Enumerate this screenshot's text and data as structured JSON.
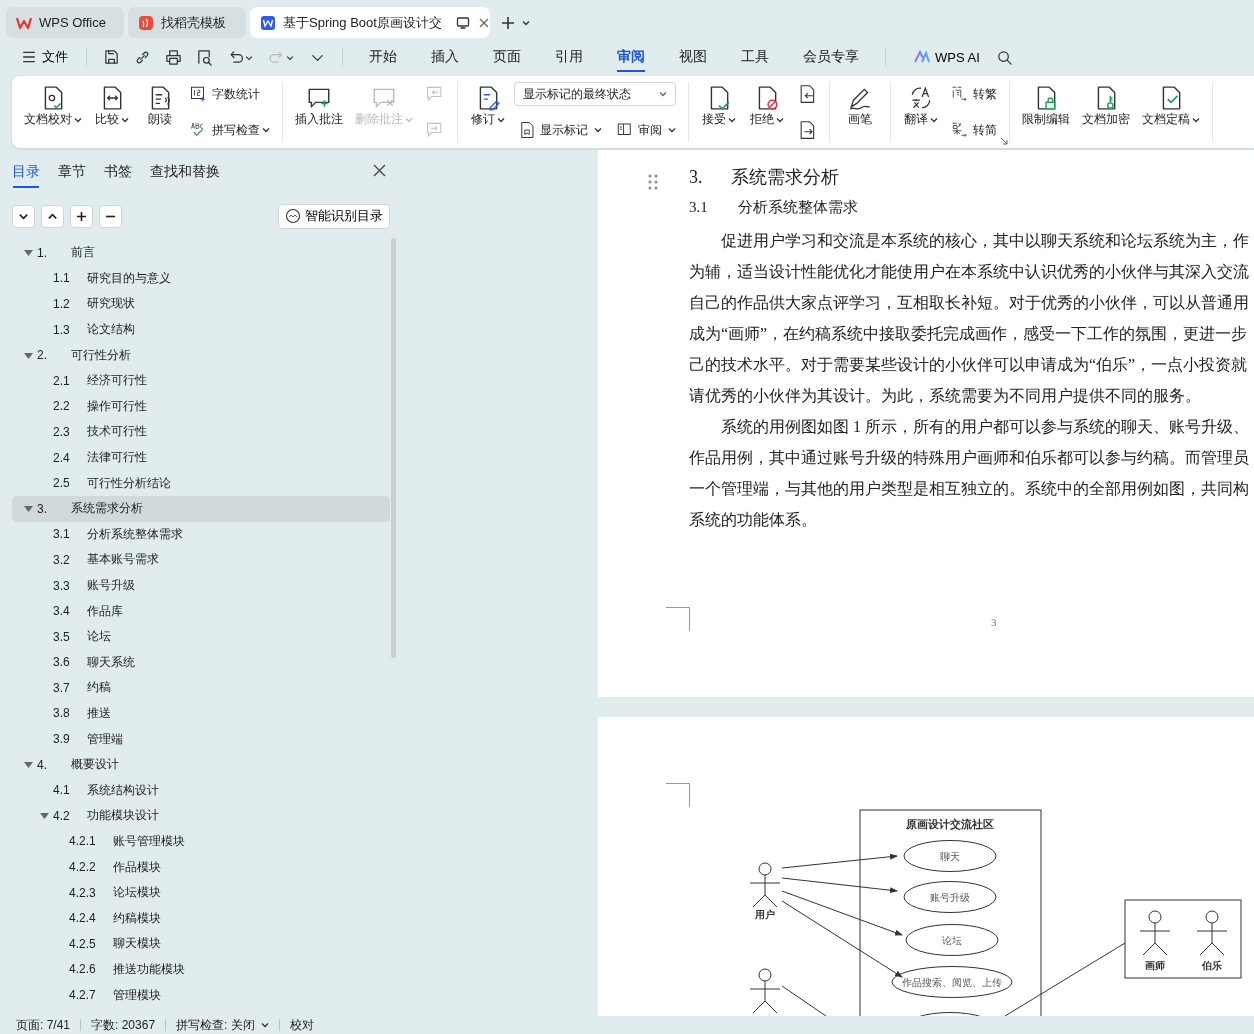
{
  "app_tabs": [
    {
      "kind": "home",
      "label": "WPS Office",
      "selected": false
    },
    {
      "kind": "template",
      "label": "找稻壳模板",
      "selected": false
    },
    {
      "kind": "document",
      "label": "基于Spring Boot原画设计交",
      "selected": true
    }
  ],
  "menu": {
    "file": "文件",
    "tabs": [
      {
        "label": "开始",
        "selected": false
      },
      {
        "label": "插入",
        "selected": false
      },
      {
        "label": "页面",
        "selected": false
      },
      {
        "label": "引用",
        "selected": false
      },
      {
        "label": "审阅",
        "selected": true
      },
      {
        "label": "视图",
        "selected": false
      },
      {
        "label": "工具",
        "selected": false
      },
      {
        "label": "会员专享",
        "selected": false
      }
    ],
    "ai": "WPS AI"
  },
  "ribbon": [
    [
      [
        {
          "kind": "large",
          "label": "文档校对",
          "caret": true,
          "disabled": false
        }
      ],
      [
        {
          "kind": "large",
          "label": "比较",
          "caret": true,
          "disabled": false
        }
      ],
      [
        {
          "kind": "large",
          "label": "朗读",
          "caret": false,
          "disabled": false
        }
      ],
      [
        {
          "kind": "small",
          "label": "字数统计",
          "caret": false,
          "disabled": false
        },
        {
          "kind": "small",
          "label": "拼写检查",
          "caret": true,
          "disabled": false
        }
      ]
    ],
    [
      [
        {
          "kind": "large",
          "label": "插入批注",
          "caret": false,
          "disabled": false
        }
      ],
      [
        {
          "kind": "large",
          "label": "删除批注",
          "caret": true,
          "disabled": true
        }
      ],
      [
        {
          "kind": "icon",
          "disabled": true
        },
        {
          "kind": "icon",
          "disabled": true
        }
      ]
    ],
    [
      [
        {
          "kind": "large",
          "label": "修订",
          "caret": true,
          "disabled": false
        }
      ],
      [
        {
          "kind": "select",
          "label": "显示标记的最终状态"
        },
        {
          "kind": "pair",
          "items": [
            {
              "label": "显示标记",
              "caret": true
            },
            {
              "label": "审阅",
              "caret": true
            }
          ]
        }
      ]
    ],
    [
      [
        {
          "kind": "large",
          "label": "接受",
          "caret": true,
          "disabled": false
        }
      ],
      [
        {
          "kind": "large",
          "label": "拒绝",
          "caret": true,
          "disabled": false
        }
      ],
      [
        {
          "kind": "icon",
          "disabled": false
        },
        {
          "kind": "icon",
          "disabled": false
        }
      ]
    ],
    [
      [
        {
          "kind": "large",
          "label": "画笔",
          "caret": false,
          "disabled": false
        }
      ]
    ],
    [
      [
        {
          "kind": "large",
          "label": "翻译",
          "caret": true,
          "disabled": false
        }
      ],
      [
        {
          "kind": "small",
          "label": "转繁",
          "caret": false,
          "disabled": false
        },
        {
          "kind": "small",
          "label": "转简",
          "caret": false,
          "disabled": false
        }
      ]
    ],
    [
      [
        {
          "kind": "large",
          "label": "限制编辑",
          "caret": false,
          "disabled": false
        }
      ],
      [
        {
          "kind": "large",
          "label": "文档加密",
          "caret": false,
          "disabled": false
        }
      ],
      [
        {
          "kind": "large",
          "label": "文档定稿",
          "caret": true,
          "disabled": false
        }
      ]
    ]
  ],
  "nav_panel": {
    "tabs": [
      {
        "label": "目录",
        "selected": true
      },
      {
        "label": "章节",
        "selected": false
      },
      {
        "label": "书签",
        "selected": false
      },
      {
        "label": "查找和替换",
        "selected": false
      }
    ],
    "smart_button": "智能识别目录",
    "outline": [
      {
        "number": "1.",
        "title": "前言",
        "expanded": true,
        "selected": false,
        "children": [
          {
            "number": "1.1",
            "title": "研究目的与意义",
            "selected": false
          },
          {
            "number": "1.2",
            "title": "研究现状",
            "selected": false
          },
          {
            "number": "1.3",
            "title": "论文结构",
            "selected": false
          }
        ]
      },
      {
        "number": "2.",
        "title": "可行性分析",
        "expanded": true,
        "selected": false,
        "children": [
          {
            "number": "2.1",
            "title": "经济可行性",
            "selected": false
          },
          {
            "number": "2.2",
            "title": "操作可行性",
            "selected": false
          },
          {
            "number": "2.3",
            "title": "技术可行性",
            "selected": false
          },
          {
            "number": "2.4",
            "title": "法律可行性",
            "selected": false
          },
          {
            "number": "2.5",
            "title": "可行性分析结论",
            "selected": false
          }
        ]
      },
      {
        "number": "3.",
        "title": "系统需求分析",
        "expanded": true,
        "selected": true,
        "children": [
          {
            "number": "3.1",
            "title": "分析系统整体需求",
            "selected": false
          },
          {
            "number": "3.2",
            "title": "基本账号需求",
            "selected": false
          },
          {
            "number": "3.3",
            "title": "账号升级",
            "selected": false
          },
          {
            "number": "3.4",
            "title": "作品库",
            "selected": false
          },
          {
            "number": "3.5",
            "title": "论坛",
            "selected": false
          },
          {
            "number": "3.6",
            "title": "聊天系统",
            "selected": false
          },
          {
            "number": "3.7",
            "title": "约稿",
            "selected": false
          },
          {
            "number": "3.8",
            "title": "推送",
            "selected": false
          },
          {
            "number": "3.9",
            "title": "管理端",
            "selected": false
          }
        ]
      },
      {
        "number": "4.",
        "title": "概要设计",
        "expanded": true,
        "selected": false,
        "children": [
          {
            "number": "4.1",
            "title": "系统结构设计",
            "selected": false
          },
          {
            "number": "4.2",
            "title": "功能模块设计",
            "expanded": true,
            "selected": false,
            "children": [
              {
                "number": "4.2.1",
                "title": "账号管理模块",
                "selected": false
              },
              {
                "number": "4.2.2",
                "title": "作品模块",
                "selected": false
              },
              {
                "number": "4.2.3",
                "title": "论坛模块",
                "selected": false
              },
              {
                "number": "4.2.4",
                "title": "约稿模块",
                "selected": false
              },
              {
                "number": "4.2.5",
                "title": "聊天模块",
                "selected": false
              },
              {
                "number": "4.2.6",
                "title": "推送功能模块",
                "selected": false
              },
              {
                "number": "4.2.7",
                "title": "管理模块",
                "selected": false
              }
            ]
          }
        ]
      }
    ]
  },
  "page": {
    "heading": {
      "number": "3.",
      "title": "系统需求分析"
    },
    "subheading": {
      "number": "3.1",
      "title": "分析系统整体需求"
    },
    "paragraphs": [
      {
        "lines": [
          "促进用户学习和交流是本系统的核心，其中以聊天系统和论坛系统为主，作",
          "为辅，适当设计性能优化才能使用户在本系统中认识优秀的小伙伴与其深入交流",
          "自己的作品供大家点评学习，互相取长补短。对于优秀的小伙伴，可以从普通用",
          "成为“画师”，在约稿系统中接取委托完成画作，感受一下工作的氛围，更进一步",
          "己的技术水平。对于需要某些设计的小伙伴可以申请成为“伯乐”，一点小投资就",
          "请优秀的小伙伴为其设计。为此，系统需要为不同用户提供不同的服务。"
        ]
      },
      {
        "lines": [
          "系统的用例图如图 1 所示，所有的用户都可以参与系统的聊天、账号升级、",
          "作品用例，其中通过账号升级的特殊用户画师和伯乐都可以参与约稿。而管理员",
          "一个管理端，与其他的用户类型是相互独立的。系统中的全部用例如图，共同构",
          "系统的功能体系。"
        ]
      }
    ],
    "page_number": "3"
  },
  "diagram": {
    "title": "原画设计交流社区",
    "user_actor": "用户",
    "use_cases": [
      "聊天",
      "账号升级",
      "论坛",
      "作品搜索、阅览、上传"
    ],
    "role_actors": [
      "画师",
      "伯乐"
    ]
  },
  "status_bar": [
    {
      "label": "页面: 7/41",
      "caret": false
    },
    {
      "label": "字数: 20367",
      "caret": false
    },
    {
      "label": "拼写检查: 关闭",
      "caret": true
    },
    {
      "label": "校对",
      "caret": false
    }
  ]
}
